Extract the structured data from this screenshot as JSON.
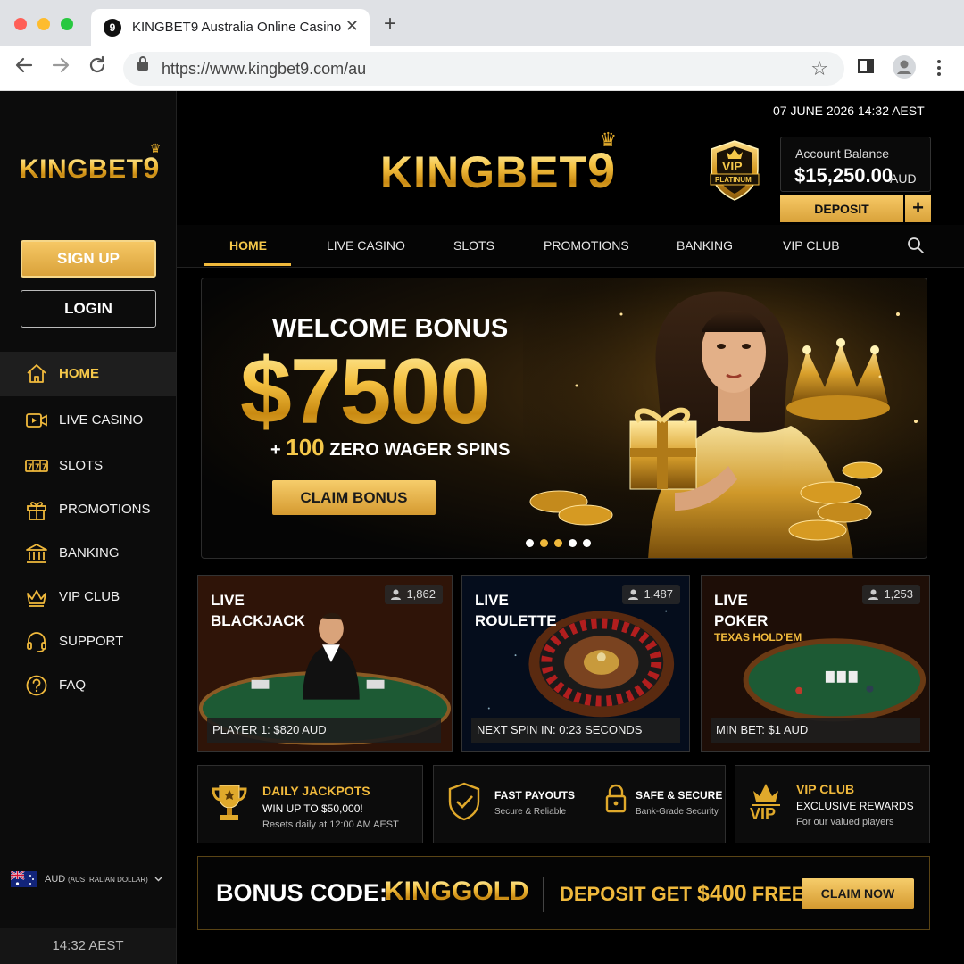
{
  "browser": {
    "tab_title": "KINGBET9 Australia Online Casino",
    "tab_close": "✕",
    "new_tab": "+",
    "favicon": "9",
    "url": "https://www.kingbet9.com/au"
  },
  "brand": {
    "name": "KINGBET",
    "digit": "9"
  },
  "sidebar": {
    "signup_label": "SIGN UP",
    "login_label": "LOGIN",
    "items": [
      {
        "label": "HOME",
        "icon": "home-icon"
      },
      {
        "label": "LIVE CASINO",
        "icon": "video-icon"
      },
      {
        "label": "SLOTS",
        "icon": "slots-icon"
      },
      {
        "label": "PROMOTIONS",
        "icon": "gift-icon"
      },
      {
        "label": "BANKING",
        "icon": "bank-icon"
      },
      {
        "label": "VIP CLUB",
        "icon": "crown-icon"
      },
      {
        "label": "SUPPORT",
        "icon": "headset-icon"
      },
      {
        "label": "FAQ",
        "icon": "question-icon"
      }
    ],
    "currency": {
      "code": "AUD",
      "name": "(AUSTRALIAN DOLLAR)"
    },
    "clock": "14:32 AEST"
  },
  "header": {
    "datetime": "07 JUNE 2026 14:32 AEST",
    "vip": {
      "top": "VIP",
      "tier": "PLATINUM"
    },
    "balance": {
      "label": "Account Balance",
      "amount": "$15,250.00",
      "currency": "AUD"
    },
    "deposit_label": "DEPOSIT",
    "plus_label": "+"
  },
  "nav": {
    "items": [
      "HOME",
      "LIVE CASINO",
      "SLOTS",
      "PROMOTIONS",
      "BANKING",
      "VIP CLUB"
    ],
    "active": "HOME"
  },
  "hero": {
    "headline": "WELCOME BONUS",
    "amount": "$7500",
    "spins_prefix": "+",
    "spins_count": "100",
    "spins_text": "ZERO WAGER SPINS",
    "cta": "CLAIM BONUS",
    "slides_total": 5,
    "slides_gold": [
      2,
      3
    ]
  },
  "games": [
    {
      "title_1": "LIVE",
      "title_2": "BLACKJACK",
      "subtitle": "",
      "players": "1,862",
      "footer": "PLAYER 1: $820 AUD"
    },
    {
      "title_1": "LIVE",
      "title_2": "ROULETTE",
      "subtitle": "",
      "players": "1,487",
      "footer": "NEXT SPIN IN: 0:23 SECONDS"
    },
    {
      "title_1": "LIVE",
      "title_2": "POKER",
      "subtitle": "TEXAS HOLD'EM",
      "players": "1,253",
      "footer": "MIN BET: $1 AUD"
    }
  ],
  "features": {
    "jackpot": {
      "title": "DAILY JACKPOTS",
      "line": "WIN UP TO $50,000!",
      "small": "Resets daily at 12:00 AM AEST"
    },
    "payouts": {
      "title": "FAST PAYOUTS",
      "small": "Secure & Reliable"
    },
    "secure": {
      "title": "SAFE & SECURE",
      "small": "Bank-Grade Security"
    },
    "vip": {
      "badge": "VIP",
      "title": "VIP CLUB",
      "line": "EXCLUSIVE REWARDS",
      "small": "For our valued players"
    }
  },
  "promo": {
    "label": "BONUS CODE:",
    "code": "KINGGOLD",
    "offer_prefix": "DEPOSIT GET",
    "offer_amount": "$400",
    "offer_suffix": "FREE!",
    "cta": "CLAIM NOW"
  },
  "colors": {
    "gold": "#f0b93c",
    "background": "#000000",
    "panel": "#0c0c0c"
  }
}
